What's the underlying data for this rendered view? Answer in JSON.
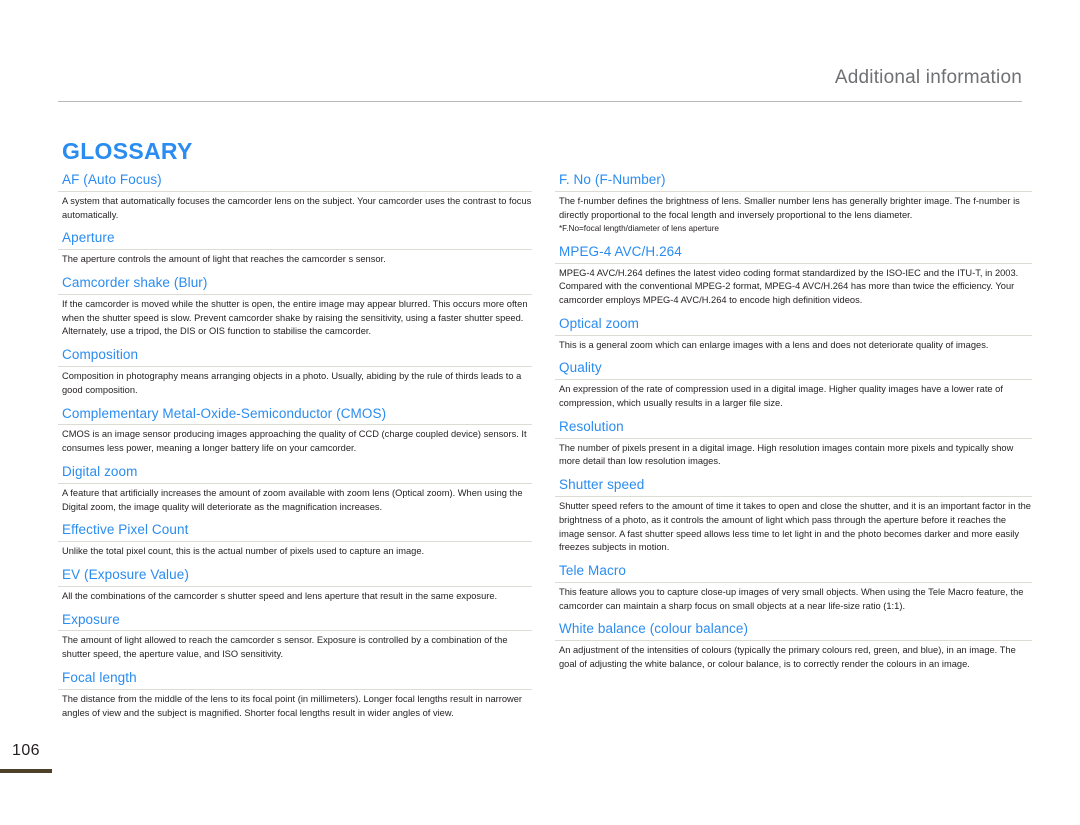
{
  "header": {
    "title": "Additional information"
  },
  "section": {
    "title": "GLOSSARY"
  },
  "folio": {
    "page_number": "106"
  },
  "colors": {
    "accent_blue": "#2a8cf0",
    "header_gray": "#6f7073",
    "rule_gray": "#b9babc",
    "entry_rule": "#dedbd2",
    "folio_bar": "#4d4229",
    "body_text": "#231f20"
  },
  "columns": {
    "left": [
      {
        "term": "AF (Auto Focus)",
        "definition": "A system that automatically focuses the camcorder lens on the subject. Your camcorder uses the contrast to focus automatically."
      },
      {
        "term": "Aperture",
        "definition": "The aperture controls the amount of light that reaches the camcorder s sensor."
      },
      {
        "term": "Camcorder shake (Blur)",
        "definition": "If the camcorder is moved while the shutter is open, the entire image may appear blurred. This occurs more often when the shutter speed is slow. Prevent camcorder shake by raising the sensitivity, using a faster shutter speed. Alternately, use a tripod, the DIS or OIS function to stabilise the camcorder."
      },
      {
        "term": "Composition",
        "definition": "Composition in photography means arranging objects in a photo. Usually, abiding by the rule of thirds leads to a good composition."
      },
      {
        "term": "Complementary Metal-Oxide-Semiconductor (CMOS)",
        "definition": "CMOS is an image sensor producing images approaching the quality of CCD (charge coupled device) sensors. It consumes less power, meaning a longer battery life on your camcorder."
      },
      {
        "term": "Digital zoom",
        "definition": "A feature that artificially increases the amount of zoom available with zoom lens (Optical zoom). When using the Digital zoom, the image quality will deteriorate as the magnification increases."
      },
      {
        "term": "Effective Pixel Count",
        "definition": "Unlike the total pixel count, this is the actual number of pixels used to capture an image."
      },
      {
        "term": "EV (Exposure Value)",
        "definition": "All the combinations of the camcorder s shutter speed and lens aperture that result in the same exposure."
      },
      {
        "term": "Exposure",
        "definition": "The amount of light allowed to reach the camcorder s sensor. Exposure is controlled by a combination of the shutter speed, the aperture value, and ISO sensitivity."
      },
      {
        "term": "Focal length",
        "definition": "The distance from the middle of the lens to its focal point (in millimeters). Longer focal lengths result in narrower angles of view and the subject is magnified. Shorter focal lengths result in wider angles of view."
      }
    ],
    "right": [
      {
        "term": "F. No (F-Number)",
        "definition": "The f-number defines the brightness of lens. Smaller number lens has generally brighter image. The f-number is directly proportional to the focal length and inversely proportional to the lens diameter.",
        "note": "*F.No=focal length/diameter of lens aperture"
      },
      {
        "term": "MPEG-4 AVC/H.264",
        "definition": "MPEG-4 AVC/H.264 defines the latest video coding format standardized by the ISO-IEC and the ITU-T, in 2003. Compared with the conventional MPEG-2 format, MPEG-4 AVC/H.264 has more than twice the efficiency. Your camcorder employs MPEG-4 AVC/H.264 to encode high definition videos."
      },
      {
        "term": "Optical zoom",
        "definition": "This is a general zoom which can enlarge images with a lens and does not deteriorate quality of images."
      },
      {
        "term": "Quality",
        "definition": "An expression of the rate of compression used in a digital image. Higher quality images have a lower rate of compression, which usually results in a larger file size."
      },
      {
        "term": "Resolution",
        "definition": "The number of pixels present in a digital image. High resolution images contain more pixels and typically show more detail than low resolution images."
      },
      {
        "term": "Shutter speed",
        "definition": "Shutter speed refers to the amount of time it takes to open and close the shutter, and it is an important factor in the brightness of a photo, as it controls the amount of light which pass through the aperture before it reaches the image sensor. A fast shutter speed allows less time to let light in and the photo becomes darker and more easily freezes subjects in motion."
      },
      {
        "term": "Tele Macro",
        "definition": "This feature allows you to capture close-up images of very small objects. When using the Tele Macro feature, the camcorder can maintain a sharp focus on small objects at a near life-size ratio (1:1)."
      },
      {
        "term": "White balance (colour balance)",
        "definition": "An adjustment of the intensities of colours (typically the primary colours red, green, and blue), in an image. The goal of adjusting the white balance, or colour balance, is to correctly render the colours in an image."
      }
    ]
  }
}
